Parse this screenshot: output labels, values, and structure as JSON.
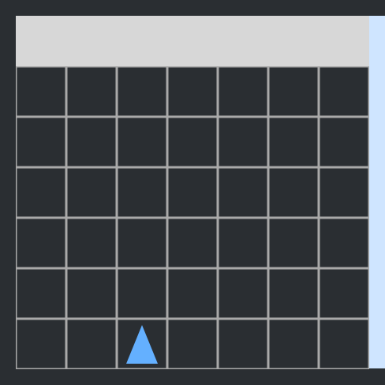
{
  "colors": {
    "background": "#2a2e32",
    "header": "#d7d7d7",
    "side_panel": "#cfe5ff",
    "grid_line": "#a9a9a9",
    "player": "#64b0ff"
  },
  "grid": {
    "columns": 7,
    "rows": 6
  },
  "player": {
    "icon": "triangle-up-icon",
    "column": 2,
    "row": 5
  }
}
